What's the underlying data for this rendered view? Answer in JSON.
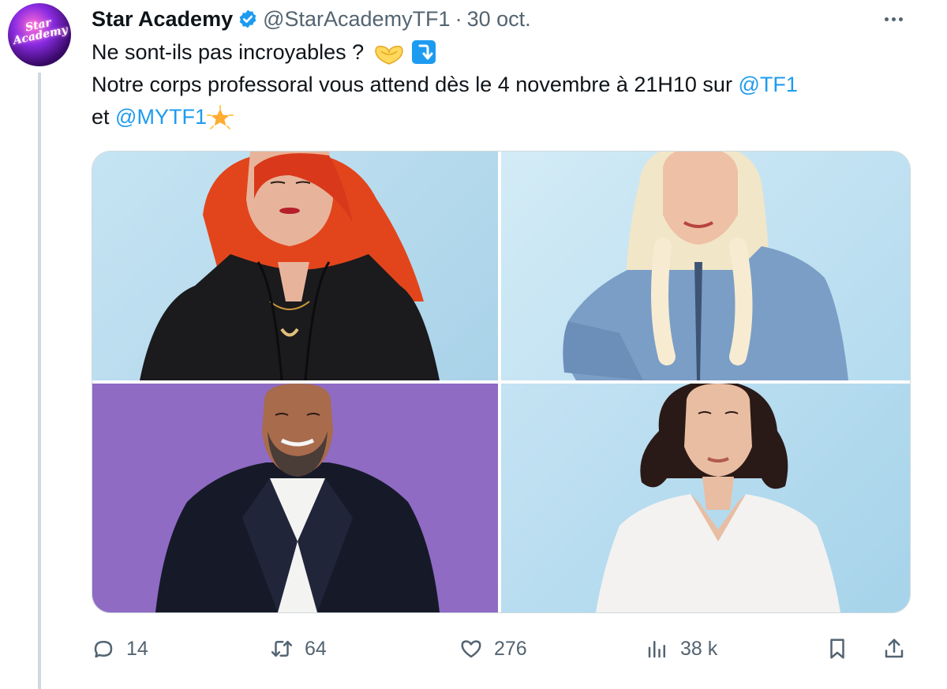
{
  "account": {
    "display_name": "Star Academy",
    "handle": "@StarAcademyTF1",
    "separator": "·",
    "date": "30 oct.",
    "avatar_text": "Star Academy"
  },
  "tweet": {
    "line1": "Ne sont-ils pas incroyables ?",
    "line2": "Notre corps professoral vous attend dès le 4 novembre à 21H10 sur",
    "mention1": "@TF1",
    "line3_prefix": "et",
    "mention2": "@MYTF1"
  },
  "media": {
    "photos": [
      {
        "name": "photo-red-hair-woman",
        "background": "#b3d8ec"
      },
      {
        "name": "photo-blonde-woman",
        "background": "#c1e1f2"
      },
      {
        "name": "photo-bearded-man",
        "background": "#8f6bc4"
      },
      {
        "name": "photo-dark-hair-woman",
        "background": "#b2d9ee"
      }
    ]
  },
  "actions": {
    "replies": "14",
    "retweets": "64",
    "likes": "276",
    "views": "38 k"
  },
  "icons": [
    "verified-icon",
    "more-icon",
    "reply-icon",
    "retweet-icon",
    "like-icon",
    "views-icon",
    "bookmark-icon",
    "share-icon"
  ],
  "colors": {
    "accent": "#1d9bf0",
    "muted": "#536471",
    "text": "#0f1419"
  }
}
